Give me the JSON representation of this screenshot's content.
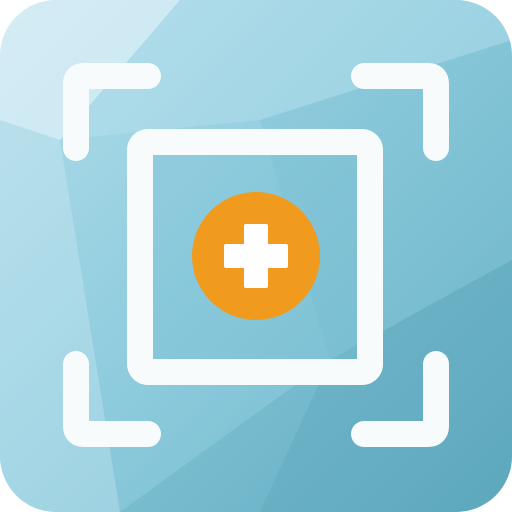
{
  "icon": {
    "semantic": "screenshot-capture-add-icon",
    "colors": {
      "background_light": "#c9e7f1",
      "background_mid": "#8ecbdc",
      "background_dark": "#5aa9bf",
      "frame": "#f8fbfc",
      "accent": "#f09a1e",
      "plus": "#ffffff"
    }
  }
}
